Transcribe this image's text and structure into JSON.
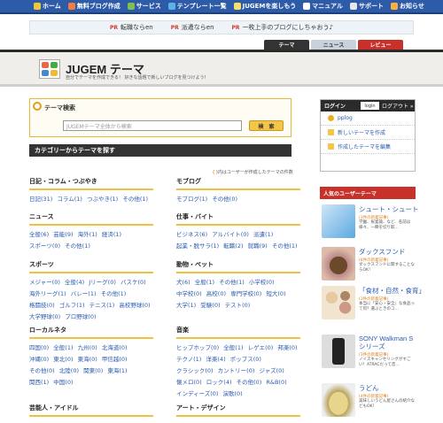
{
  "gnav": [
    "ホーム",
    "無料ブログ作成",
    "サービス",
    "テンプレート一覧",
    "JUGEMを楽しもう",
    "マニュアル",
    "サポート",
    "お知らせ"
  ],
  "promo": [
    {
      "tag": "PR",
      "text": "転職ならen"
    },
    {
      "tag": "PR",
      "text": "派遣ならen"
    },
    {
      "tag": "PR",
      "text": "一枚上手のブログにしちゃおう♪"
    }
  ],
  "tabs": {
    "theme": "テーマ",
    "news": "ニュース",
    "review": "レビュー"
  },
  "header": {
    "title": "JUGEM テーマ",
    "subtitle": "自分でテーマを作成できる！ 好きな話題で新しいブログを見つけよう！"
  },
  "search": {
    "title": "テーマ検索",
    "placeholder": "JUGEMテーマ全体から検索",
    "button": "検　索"
  },
  "category": {
    "bar": "カテゴリーからテーマを探す",
    "note_paren": "(",
    "note_rest": " )内はユーザーが作成したテーマの件数"
  },
  "cats": [
    {
      "title": "日記・コラム・つぶやき",
      "links": [
        "日記(31)",
        "コラム(1)",
        "つぶやき(1)",
        "その他(1)"
      ]
    },
    {
      "title": "モブログ",
      "links": [
        "モブログ(1)",
        "その他(0)"
      ]
    },
    {
      "title": "ニュース",
      "links": [
        "全般(6)",
        "芸能(9)",
        "海外(1)",
        "経済(1)",
        "スポーツ(0)",
        "その他(1)"
      ]
    },
    {
      "title": "仕事・バイト",
      "links": [
        "ビジネス(6)",
        "アルバイト(0)",
        "派遣(1)",
        "起業・脱サラ(1)",
        "転職(2)",
        "就職(9)",
        "その他(1)"
      ]
    },
    {
      "title": "スポーツ",
      "links": [
        "メジャー(0)",
        "全般(4)",
        "Jリーグ(0)",
        "バスケ(0)",
        "海外リーグ(1)",
        "バレー(1)",
        "その他(1)",
        "格闘技(0)",
        "ゴルフ(1)",
        "テニス(1)",
        "高校野球(0)",
        "大学野球(0)",
        "プロ野球(0)"
      ]
    },
    {
      "title": "動物・ペット",
      "links": [
        "犬(6)",
        "全般(1)",
        "その他(1)",
        "小学校(0)",
        "中学校(0)",
        "高校(0)",
        "専門学校(0)",
        "短大(0)",
        "大学(1)",
        "受験(0)",
        "テスト(0)"
      ]
    },
    {
      "title": "ローカルネタ",
      "links": [
        "四国(0)",
        "全般(1)",
        "九州(0)",
        "北海道(0)",
        "沖縄(0)",
        "東北(0)",
        "東海(0)",
        "甲信越(0)",
        "その他(0)",
        "北陸(0)",
        "関東(0)",
        "東海(1)",
        "関西(1)",
        "中国(0)"
      ]
    },
    {
      "title": "音楽",
      "links": [
        "ヒップホップ(0)",
        "全般(1)",
        "レゲエ(0)",
        "邦楽(0)",
        "テクノ(1)",
        "洋楽(4)",
        "ポップス(0)",
        "クラシック(0)",
        "カントリー(0)",
        "ジャズ(0)",
        "懐メロ(0)",
        "ロック(4)",
        "その他(0)",
        "R&B(0)",
        "インディーズ(0)",
        "演歌(0)"
      ]
    },
    {
      "title": "芸能人・アイドル",
      "links": []
    },
    {
      "title": "アート・デザイン",
      "links": []
    }
  ],
  "login": {
    "title": "ログイン",
    "login_btn": "login",
    "logout": "ログアウト »",
    "items": [
      "pplog",
      "新しいテーマを作成",
      "作成したテーマを編集"
    ]
  },
  "popular": {
    "title": "人気のユーザーテーマ",
    "items": [
      {
        "title": "シュート・シュート",
        "count": "(3件の新着記事)",
        "desc": "学園、祝宴論、など、名前は様々、一瞬を切り取..."
      },
      {
        "title": "ダックスフンド",
        "count": "(8件の新着記事)",
        "desc": "ダックスフンドに関することならOK！"
      },
      {
        "title": "「食材・自然・食育」",
        "count": "(3件の新着記事)",
        "desc": "本当に「安心・安全」な食品って何？選ぶときのコ..."
      },
      {
        "title": "SONY Walkman Sシリーズ",
        "count": "(3件の新着記事)",
        "desc": "ノイズキャンセリングがすごい！ATRACだって音..."
      },
      {
        "title": "うどん",
        "count": "(4件の新着記事)",
        "desc": "美味しいうどん屋さんの紹介などもOK！"
      }
    ]
  }
}
